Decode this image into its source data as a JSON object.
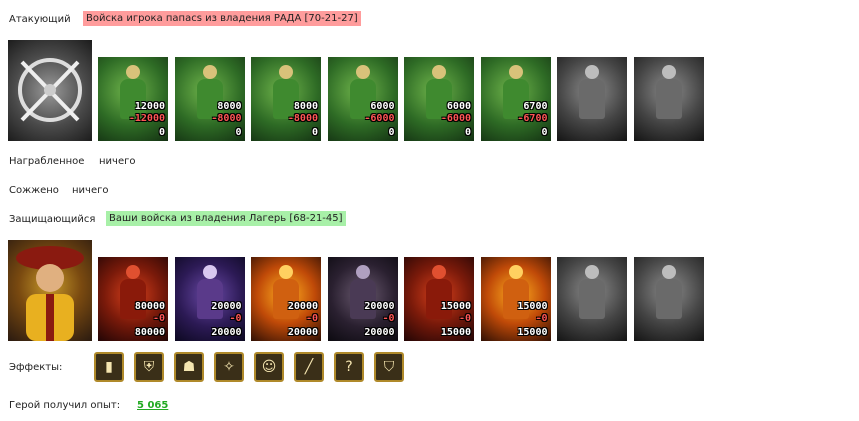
{
  "attacker": {
    "label": "Атакующий",
    "title": "Войска игрока папасs из владения РАДА [70-21-27]",
    "units": [
      {
        "icon": "dwarf-warrior-icon",
        "c1": "12000",
        "c2": "-12000",
        "c3": "0",
        "style": "green"
      },
      {
        "icon": "knight-icon",
        "c1": "8000",
        "c2": "-8000",
        "c3": "0",
        "style": "green"
      },
      {
        "icon": "paladin-icon",
        "c1": "8000",
        "c2": "-8000",
        "c3": "0",
        "style": "green"
      },
      {
        "icon": "griffin-icon",
        "c1": "6000",
        "c2": "-6000",
        "c3": "0",
        "style": "green"
      },
      {
        "icon": "archer-icon",
        "c1": "6000",
        "c2": "-6000",
        "c3": "0",
        "style": "green"
      },
      {
        "icon": "druid-icon",
        "c1": "6700",
        "c2": "-6700",
        "c3": "0",
        "style": "green"
      },
      {
        "icon": "empty-slot-icon",
        "c1": "",
        "c2": "",
        "c3": "",
        "style": "gray"
      },
      {
        "icon": "empty-slot-icon",
        "c1": "",
        "c2": "",
        "c3": "",
        "style": "gray"
      }
    ]
  },
  "looted": {
    "label": "Награбленное",
    "value": "ничего"
  },
  "burned": {
    "label": "Сожжено",
    "value": "ничего"
  },
  "defender": {
    "label": "Защищающийся",
    "title": "Ваши войска из владения Лагерь [68-21-45]",
    "units": [
      {
        "icon": "red-dragon-icon",
        "c1": "80000",
        "c2": "-0",
        "c3": "80000",
        "style": "red"
      },
      {
        "icon": "skeleton-mage-icon",
        "c1": "20000",
        "c2": "-0",
        "c3": "20000",
        "style": "purple"
      },
      {
        "icon": "fire-elemental-icon",
        "c1": "20000",
        "c2": "-0",
        "c3": "20000",
        "style": "fire"
      },
      {
        "icon": "demon-icon",
        "c1": "20000",
        "c2": "-0",
        "c3": "20000",
        "style": "dark"
      },
      {
        "icon": "magma-golem-icon",
        "c1": "15000",
        "c2": "-0",
        "c3": "15000",
        "style": "red"
      },
      {
        "icon": "fire-warrior-icon",
        "c1": "15000",
        "c2": "-0",
        "c3": "15000",
        "style": "fire"
      },
      {
        "icon": "empty-slot-icon",
        "c1": "",
        "c2": "",
        "c3": "",
        "style": "gray"
      },
      {
        "icon": "empty-slot-icon",
        "c1": "",
        "c2": "",
        "c3": "",
        "style": "gray"
      }
    ]
  },
  "effects": {
    "label": "Эффекты:",
    "icons": [
      {
        "icon": "tower-icon",
        "glyph": "▮"
      },
      {
        "icon": "shield-icon",
        "glyph": "⛨"
      },
      {
        "icon": "hooded-figure-icon",
        "glyph": "☗"
      },
      {
        "icon": "star-rune-icon",
        "glyph": "✧"
      },
      {
        "icon": "warrior-portrait-icon",
        "glyph": "☺"
      },
      {
        "icon": "scroll-icon",
        "glyph": "╱"
      },
      {
        "icon": "question-icon",
        "glyph": "?"
      },
      {
        "icon": "beast-shield-icon",
        "glyph": "⛉"
      }
    ]
  },
  "experience": {
    "label": "Герой получил опыт:",
    "value": "5 065"
  }
}
